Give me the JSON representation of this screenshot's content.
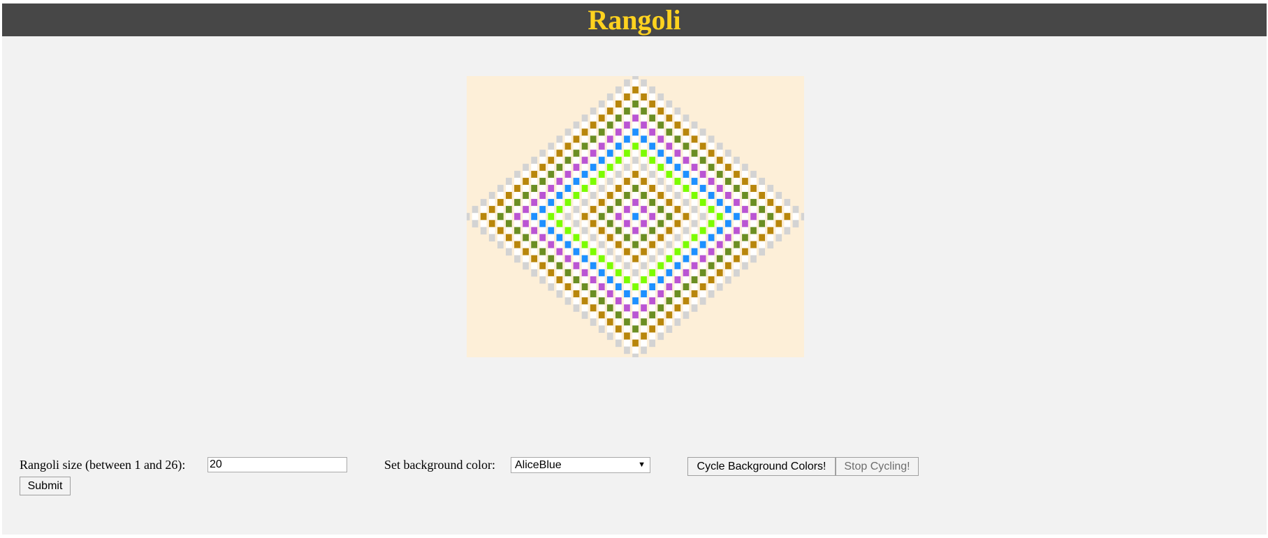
{
  "header": {
    "title": "Rangoli"
  },
  "rangoli": {
    "size": 20,
    "background_color": "#fdefd8",
    "palette": [
      "#d3d3d3",
      "#8b4513",
      "#b8860b",
      "#add8e6",
      "#6b8e23",
      "#808080",
      "#ba55d3",
      "#8b008b",
      "#1e90ff",
      "#cd853f",
      "#7cfc00",
      "#ffc0cb",
      "#ffffff"
    ]
  },
  "controls": {
    "size_label": "Rangoli size (between 1 and 26):",
    "size_value": "20",
    "bg_label": "Set background color:",
    "bg_selected": "AliceBlue",
    "cycle_button": "Cycle Background Colors!",
    "stop_button": "Stop Cycling!",
    "submit_button": "Submit"
  },
  "colors": {
    "header_bg": "#474747",
    "title_color": "#ffd21f",
    "page_bg": "#f2f2f2"
  }
}
